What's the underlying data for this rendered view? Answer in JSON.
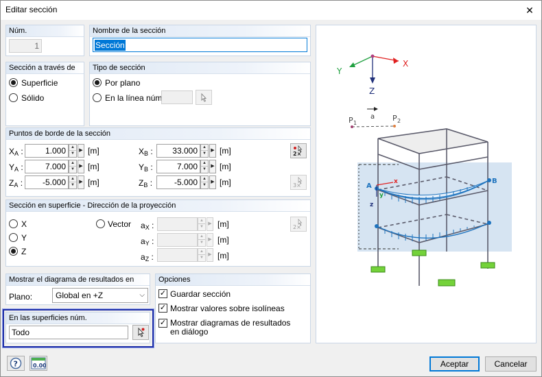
{
  "window": {
    "title": "Editar sección",
    "close_glyph": "✕"
  },
  "num_group": {
    "label": "Núm.",
    "value": "1"
  },
  "name_group": {
    "label": "Nombre de la sección",
    "value": "Sección"
  },
  "section_through": {
    "label": "Sección a través de",
    "options": [
      "Superficie",
      "Sólido"
    ],
    "selected": "Superficie"
  },
  "section_type": {
    "label": "Tipo de sección",
    "options": [
      "Por plano",
      "En la línea núm.:"
    ],
    "selected": "Por plano"
  },
  "edge_points": {
    "label": "Puntos de borde de la sección",
    "unit": "[m]",
    "left": [
      {
        "name": "X",
        "sub": "A",
        "value": "1.000"
      },
      {
        "name": "Y",
        "sub": "A",
        "value": "7.000"
      },
      {
        "name": "Z",
        "sub": "A",
        "value": "-5.000"
      }
    ],
    "right": [
      {
        "name": "X",
        "sub": "B",
        "value": "33.000"
      },
      {
        "name": "Y",
        "sub": "B",
        "value": "7.000"
      },
      {
        "name": "Z",
        "sub": "B",
        "value": "-5.000"
      }
    ]
  },
  "projection": {
    "label": "Sección en superficie - Dirección de la proyección",
    "options": [
      "X",
      "Y",
      "Z"
    ],
    "selected": "Z",
    "vector_label": "Vector",
    "unit": "[m]",
    "components": [
      {
        "name": "a",
        "sub": "X"
      },
      {
        "name": "a",
        "sub": "Y"
      },
      {
        "name": "a",
        "sub": "Z"
      }
    ]
  },
  "diagram_group": {
    "label": "Mostrar el diagrama de resultados en",
    "plane_label": "Plano:",
    "plane_value": "Global en +Z"
  },
  "surfaces_group": {
    "label": "En las superficies núm.",
    "value": "Todo"
  },
  "options_group": {
    "label": "Opciones",
    "items": [
      {
        "label": "Guardar sección",
        "checked": true
      },
      {
        "label": "Mostrar valores sobre isolíneas",
        "checked": true
      },
      {
        "label": "Mostrar diagramas de resultados en diálogo",
        "checked": true
      }
    ]
  },
  "preview": {
    "axis_x": "X",
    "axis_y": "Y",
    "axis_z": "Z",
    "p1": "P",
    "p1_sub": "1",
    "p2": "P",
    "p2_sub": "2",
    "a": "a",
    "point_a": "A",
    "point_b": "B",
    "local_x": "x",
    "local_y": "y",
    "local_z": "z"
  },
  "footer": {
    "ok_label": "Aceptar",
    "cancel_label": "Cancelar",
    "units_icon_text": "0.00"
  },
  "colors": {
    "accent": "#0078d7",
    "group_header": "#dfe9f5",
    "highlight": "#1f2fa8",
    "diagram_blue": "#1e73be"
  }
}
